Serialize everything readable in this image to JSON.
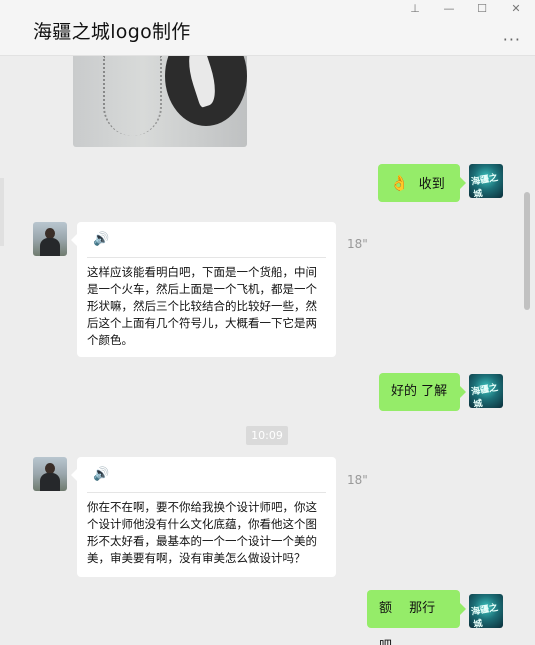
{
  "window": {
    "title": "海疆之城logo制作",
    "controls": {
      "pin": "⊥",
      "minimize": "—",
      "maximize": "☐",
      "close": "✕"
    },
    "more": "···"
  },
  "messages": {
    "m1": {
      "text": "收到",
      "emoji": "👌"
    },
    "m2": {
      "voice_icon": "🔊",
      "duration": "18\"",
      "transcript": "这样应该能看明白吧，下面是一个货船，中间是一个火车，然后上面是一个飞机，都是一个形状嘛，然后三个比较结合的比较好一些，然后这个上面有几个符号儿，大概看一下它是两个颜色。"
    },
    "m3": {
      "text": "好的 了解"
    },
    "time": "10:09",
    "m4": {
      "voice_icon": "🔊",
      "duration": "18\"",
      "transcript": "你在不在啊，要不你给我换个设计师吧，你这个设计师他没有什么文化底蕴，你看他这个图形不太好看，最基本的一个一个设计一个美的美，审美要有啊，没有审美怎么做设计吗？"
    },
    "m5": {
      "text": "额　 那行吧"
    }
  },
  "avatars": {
    "me_label": "海疆之城"
  }
}
